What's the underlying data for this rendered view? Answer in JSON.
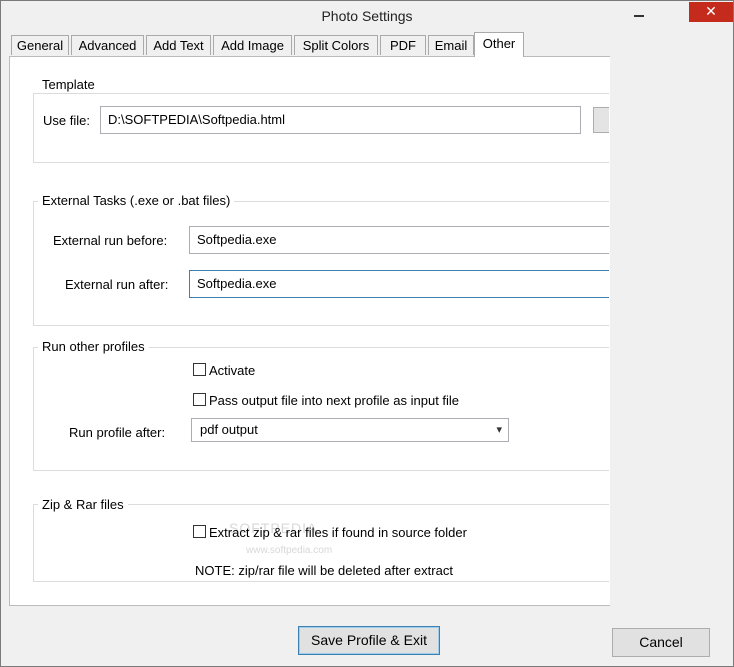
{
  "window": {
    "title": "Photo Settings",
    "close_glyph": "✕"
  },
  "tabs": [
    {
      "label": "General"
    },
    {
      "label": "Advanced"
    },
    {
      "label": "Add Text"
    },
    {
      "label": "Add Image"
    },
    {
      "label": "Split Colors"
    },
    {
      "label": "PDF"
    },
    {
      "label": "Email"
    },
    {
      "label": "Other",
      "active": true
    }
  ],
  "template": {
    "title": "Template",
    "use_file_label": "Use file:",
    "use_file_value": "D:\\SOFTPEDIA\\Softpedia.html"
  },
  "external": {
    "title": "External Tasks  (.exe or .bat files)",
    "before_label": "External run before:",
    "before_value": "Softpedia.exe",
    "after_label": "External run after:",
    "after_value": "Softpedia.exe"
  },
  "profiles": {
    "title": "Run other profiles",
    "activate_label": "Activate",
    "activate_checked": false,
    "pass_label": "Pass output file into next profile as input file",
    "pass_checked": false,
    "run_after_label": "Run profile after:",
    "run_after_value": "pdf output",
    "dropdown_glyph": "▾"
  },
  "zip": {
    "title": "Zip & Rar files",
    "extract_label": "Extract zip & rar files if found in source folder",
    "extract_checked": false,
    "note": "NOTE: zip/rar file will be deleted after extract"
  },
  "watermark": {
    "line1": "SOFTPEDIA",
    "line2": "www.softpedia.com"
  },
  "buttons": {
    "save_label": "Save Profile & Exit",
    "cancel_label": "Cancel"
  }
}
